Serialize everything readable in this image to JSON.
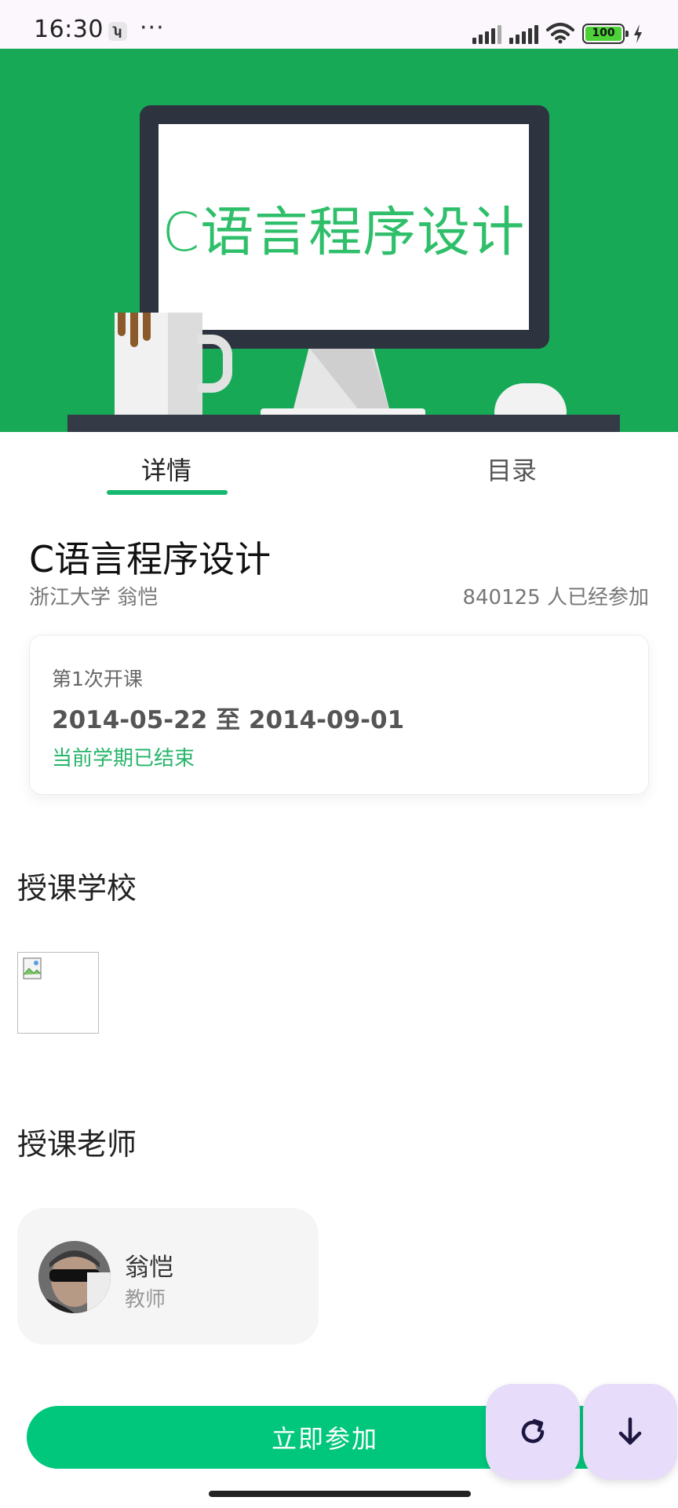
{
  "status_bar": {
    "time": "16:30",
    "app_icon": "ʮ",
    "more": "···",
    "battery_level": "100",
    "icons": [
      "signal-icon",
      "signal-icon",
      "wifi-icon",
      "battery-icon",
      "charging-icon"
    ]
  },
  "hero": {
    "screen_text": "C语言程序设计"
  },
  "tabs": [
    {
      "label": "详情",
      "active": true
    },
    {
      "label": "目录",
      "active": false
    }
  ],
  "course": {
    "title": "C语言程序设计",
    "university_teacher": "浙江大学 翁恺",
    "participants": "840125 人已经参加"
  },
  "session": {
    "label": "第1次开课",
    "dates": "2014-05-22 至 2014-09-01",
    "status": "当前学期已结束"
  },
  "sections": {
    "school_title": "授课学校",
    "teacher_title": "授课老师"
  },
  "teacher": {
    "name": "翁恺",
    "role": "教师"
  },
  "actions": {
    "join_label": "立即参加",
    "refresh_icon": "refresh-icon",
    "down_icon": "arrow-down-icon"
  },
  "colors": {
    "accent": "#00c77b",
    "hero_bg": "#18a957",
    "status_green": "#27b56a",
    "fab_bg": "#e7dcf9"
  }
}
